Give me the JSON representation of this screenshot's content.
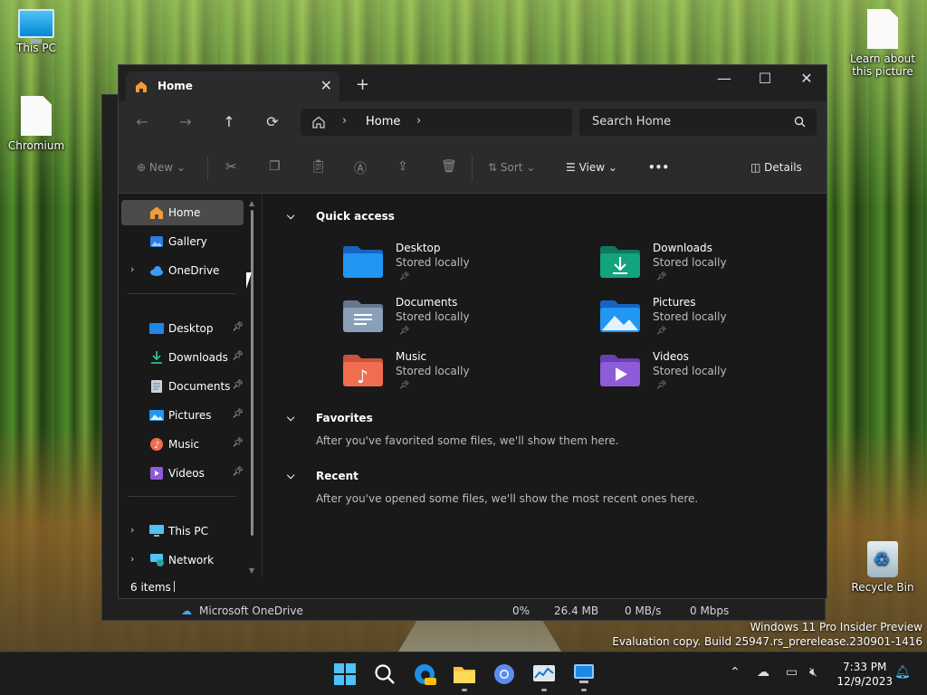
{
  "desktop": {
    "icons": [
      {
        "label": "This PC"
      },
      {
        "label": "Chromium"
      },
      {
        "label": "Learn about this picture"
      },
      {
        "label": "Recycle Bin"
      }
    ],
    "watermark": {
      "line1": "Windows 11 Pro Insider Preview",
      "line2": "Evaluation copy. Build 25947.rs_prerelease.230901-1416"
    }
  },
  "background_window": {
    "row": {
      "name": "Microsoft OneDrive",
      "cpu": "0%",
      "memory": "26.4 MB",
      "disk": "0 MB/s",
      "network": "0 Mbps"
    }
  },
  "explorer": {
    "tab": {
      "label": "Home",
      "close": "✕"
    },
    "new_tab": "+",
    "window_controls": {
      "minimize": "—",
      "maximize": "☐",
      "close": "✕"
    },
    "nav": {
      "back": "←",
      "forward": "→",
      "up": "↑",
      "refresh": "⟳"
    },
    "address": {
      "crumb": "Home",
      "sep": "›"
    },
    "search": {
      "placeholder": "Search Home"
    },
    "toolbar": {
      "new": "New",
      "sort": "Sort",
      "view": "View",
      "more": "•••",
      "details": "Details"
    },
    "sidebar": {
      "items": [
        {
          "label": "Home"
        },
        {
          "label": "Gallery"
        },
        {
          "label": "OneDrive"
        },
        {
          "label": "Desktop"
        },
        {
          "label": "Downloads"
        },
        {
          "label": "Documents"
        },
        {
          "label": "Pictures"
        },
        {
          "label": "Music"
        },
        {
          "label": "Videos"
        },
        {
          "label": "This PC"
        },
        {
          "label": "Network"
        }
      ]
    },
    "sections": {
      "quick_access": "Quick access",
      "favorites": "Favorites",
      "favorites_empty": "After you've favorited some files, we'll show them here.",
      "recent": "Recent",
      "recent_empty": "After you've opened some files, we'll show the most recent ones here."
    },
    "folders": [
      {
        "name": "Desktop",
        "sub": "Stored locally"
      },
      {
        "name": "Downloads",
        "sub": "Stored locally"
      },
      {
        "name": "Documents",
        "sub": "Stored locally"
      },
      {
        "name": "Pictures",
        "sub": "Stored locally"
      },
      {
        "name": "Music",
        "sub": "Stored locally"
      },
      {
        "name": "Videos",
        "sub": "Stored locally"
      }
    ],
    "status": {
      "count": "6 items"
    }
  },
  "taskbar": {
    "time": "7:33 PM",
    "date": "12/9/2023"
  },
  "colors": {
    "accent": "#0078d4",
    "desktop_folder": "#1e88e5",
    "downloads_folder": "#13a37f",
    "documents_folder": "#8aa0b8",
    "pictures_folder": "#2196f3",
    "music_folder": "#f06d4f",
    "videos_folder": "#8e5cd9"
  }
}
